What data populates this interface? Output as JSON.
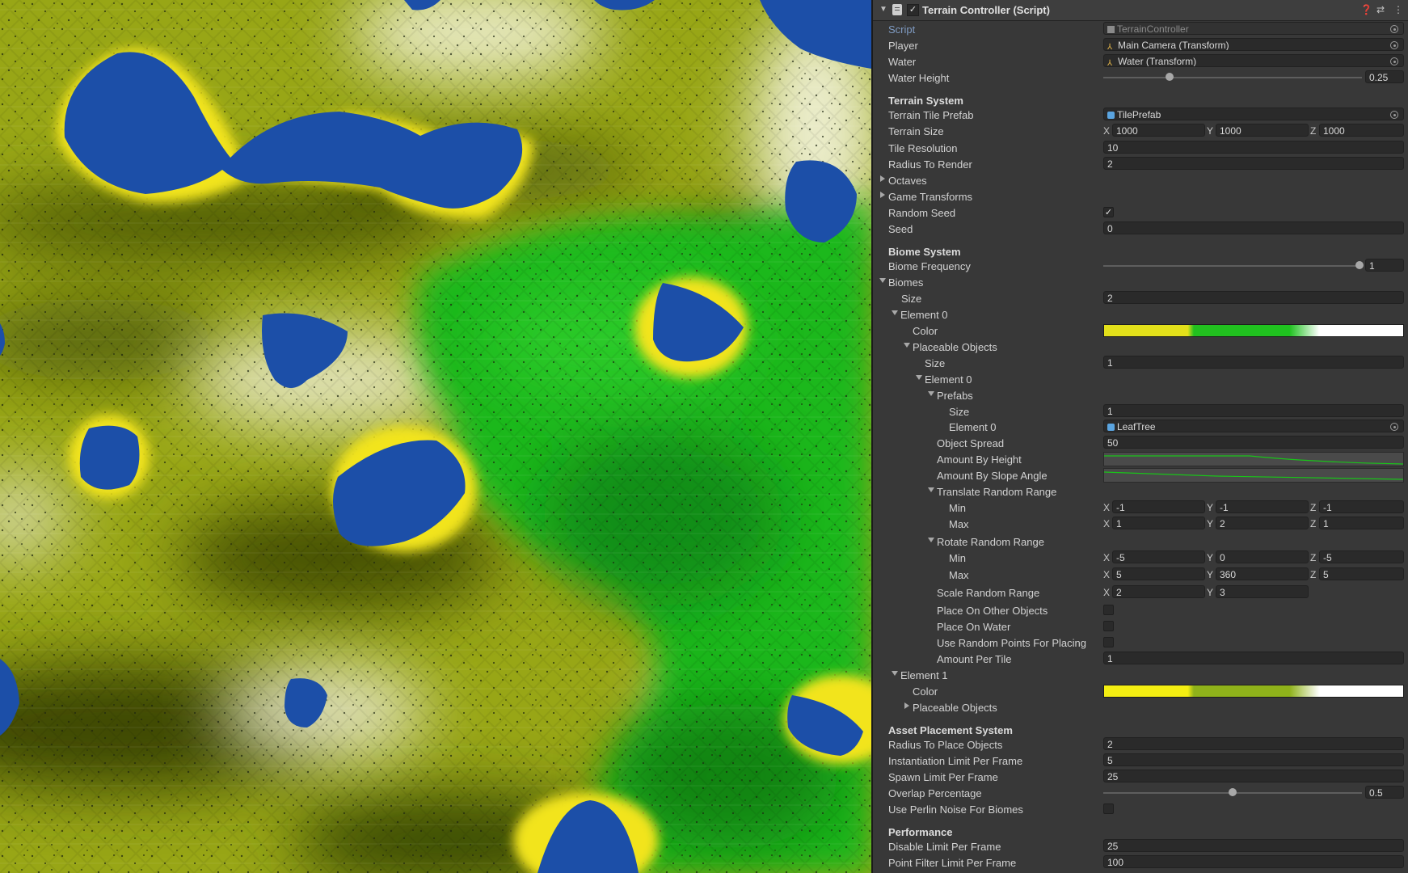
{
  "component": {
    "title": "Terrain Controller (Script)",
    "enabled": true
  },
  "fields": {
    "script": {
      "label": "Script",
      "value": "TerrainController"
    },
    "player": {
      "label": "Player",
      "value": "Main Camera (Transform)"
    },
    "water": {
      "label": "Water",
      "value": "Water (Transform)"
    },
    "water_height": {
      "label": "Water Height",
      "value": "0.25",
      "fraction": 0.25
    }
  },
  "terrain_system": {
    "heading": "Terrain System",
    "tile_prefab": {
      "label": "Terrain Tile Prefab",
      "value": "TilePrefab"
    },
    "terrain_size": {
      "label": "Terrain Size",
      "x": "1000",
      "y": "1000",
      "z": "1000"
    },
    "tile_resolution": {
      "label": "Tile Resolution",
      "value": "10"
    },
    "radius_to_render": {
      "label": "Radius To Render",
      "value": "2"
    },
    "octaves": {
      "label": "Octaves"
    },
    "game_transforms": {
      "label": "Game Transforms"
    },
    "random_seed": {
      "label": "Random Seed",
      "checked": true
    },
    "seed": {
      "label": "Seed",
      "value": "0"
    }
  },
  "biome_system": {
    "heading": "Biome System",
    "biome_frequency": {
      "label": "Biome Frequency",
      "value": "1",
      "fraction": 1.0
    },
    "biomes": {
      "label": "Biomes",
      "size_label": "Size",
      "size": "2",
      "element0": {
        "label": "Element 0",
        "color_label": "Color",
        "gradient_colors": [
          "#e3e01a",
          "#e3e01a",
          "#22c01f",
          "#1fc21f",
          "#ffffff",
          "#ffffff"
        ],
        "placeable_objects": {
          "label": "Placeable Objects",
          "size_label": "Size",
          "size": "1",
          "element0": {
            "label": "Element 0",
            "prefabs": {
              "label": "Prefabs",
              "size_label": "Size",
              "size": "1",
              "el_label": "Element 0",
              "el_value": "LeafTree"
            },
            "object_spread": {
              "label": "Object Spread",
              "value": "50"
            },
            "amount_by_height": {
              "label": "Amount By Height"
            },
            "amount_by_slope": {
              "label": "Amount By Slope Angle"
            },
            "translate": {
              "label": "Translate Random Range",
              "min_label": "Min",
              "max_label": "Max",
              "min": {
                "x": "-1",
                "y": "-1",
                "z": "-1"
              },
              "max": {
                "x": "1",
                "y": "2",
                "z": "1"
              }
            },
            "rotate": {
              "label": "Rotate Random Range",
              "min_label": "Min",
              "max_label": "Max",
              "min": {
                "x": "-5",
                "y": "0",
                "z": "-5"
              },
              "max": {
                "x": "5",
                "y": "360",
                "z": "5"
              }
            },
            "scale": {
              "label": "Scale Random Range",
              "x": "2",
              "y": "3"
            },
            "place_on_other": {
              "label": "Place On Other Objects",
              "checked": false
            },
            "place_on_water": {
              "label": "Place On Water",
              "checked": false
            },
            "use_random_points": {
              "label": "Use Random Points For Placing",
              "checked": false
            },
            "amount_per_tile": {
              "label": "Amount Per Tile",
              "value": "1"
            }
          }
        }
      },
      "element1": {
        "label": "Element 1",
        "color_label": "Color",
        "gradient_colors": [
          "#f4ee12",
          "#f4ee12",
          "#8fb21a",
          "#8fb21a",
          "#ffffff",
          "#ffffff"
        ],
        "placeable_objects_label": "Placeable Objects"
      }
    }
  },
  "asset_placement": {
    "heading": "Asset Placement System",
    "radius": {
      "label": "Radius To Place Objects",
      "value": "2"
    },
    "instantiation": {
      "label": "Instantiation Limit Per Frame",
      "value": "5"
    },
    "spawn": {
      "label": "Spawn Limit Per Frame",
      "value": "25"
    },
    "overlap": {
      "label": "Overlap Percentage",
      "value": "0.5",
      "fraction": 0.5
    },
    "perlin": {
      "label": "Use Perlin Noise For Biomes",
      "checked": false
    }
  },
  "performance": {
    "heading": "Performance",
    "disable_limit": {
      "label": "Disable Limit Per Frame",
      "value": "25"
    },
    "point_filter": {
      "label": "Point Filter Limit Per Frame",
      "value": "100"
    }
  },
  "axis_labels": {
    "x": "X",
    "y": "Y",
    "z": "Z"
  },
  "icons": [
    "foldout-arrow-icon",
    "script-icon",
    "help-icon",
    "preset-icon",
    "more-icon",
    "object-picker-icon",
    "transform-icon",
    "prefab-icon"
  ],
  "colors": {
    "water": "#1c4fa8",
    "grass": "#9aa917",
    "biome_green": "#1fbf1f",
    "sand": "#e8df17",
    "panel": "#383838"
  }
}
